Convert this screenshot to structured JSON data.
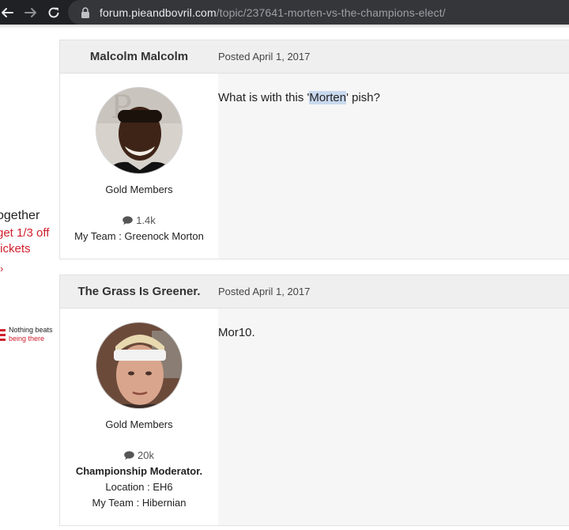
{
  "browser": {
    "url_host": "forum.pieandbovril.com",
    "url_path": "/topic/237641-morten-vs-the-champions-elect/"
  },
  "ad": {
    "line1": "ogether",
    "line2": "get 1/3 off",
    "line3": "tickets",
    "arrow": "›",
    "logo_line1": "Nothing beats",
    "logo_line2": "being there",
    "brand_color": "#d0202e"
  },
  "posts": [
    {
      "author": "Malcolm Malcolm",
      "date": "Posted April 1, 2017",
      "group": "Gold Members",
      "post_count": "1.4k",
      "team": "My Team : Greenock Morton",
      "content_before": "What is with this '",
      "content_highlight": "Morten",
      "content_after": "' pish?"
    },
    {
      "author": "The Grass Is Greener.",
      "date": "Posted April 1, 2017",
      "group": "Gold Members",
      "post_count": "20k",
      "title": "Championship Moderator.",
      "location": "Location : EH6",
      "team": "My Team : Hibernian",
      "content": "Mor10."
    }
  ],
  "icons": {
    "back": "arrow-left-icon",
    "forward": "arrow-right-icon",
    "reload": "reload-icon",
    "lock": "lock-icon",
    "posts": "comment-icon"
  }
}
